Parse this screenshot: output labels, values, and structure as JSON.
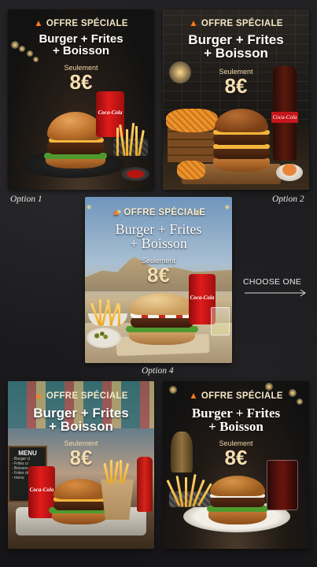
{
  "offers": [
    {
      "id": "opt1",
      "offer_title": "OFFRE SPÉCIALE",
      "headline_line1": "Burger + Frites",
      "headline_line2": "+ Boisson",
      "seulement": "Seulement",
      "price": "8€",
      "option_label": "Option 1",
      "can_logo": "Coca-Cola"
    },
    {
      "id": "opt2",
      "offer_title": "OFFRE SPÉCIALE",
      "headline_line1": "Burger + Frites",
      "headline_line2": "+ Boisson",
      "seulement": "Seulement",
      "price": "8€",
      "option_label": "Option 2",
      "can_logo": "Coca-Cola"
    },
    {
      "id": "opt4",
      "offer_title": "OFFRE SPÉCIALE",
      "headline_line1": "Burger + Frites",
      "headline_line2": "+ Boisson",
      "seulement": "Seulement",
      "price": "8€",
      "option_label": "Option 4",
      "can_logo": "Coca-Cola"
    },
    {
      "id": "opt5",
      "offer_title": "OFFRE SPÉCIALE",
      "headline_line1": "Burger + Frites",
      "headline_line2": "+ Boisson",
      "seulement": "Seulement",
      "price": "8€",
      "can_logo": "Coca-Cola",
      "menu_title": "MENU",
      "menu_lines": [
        "- Burger cl",
        "- Frites cr",
        "- Boisson",
        "- Frites di",
        "- menu"
      ]
    },
    {
      "id": "opt6",
      "offer_title": "OFFRE SPÉCIALE",
      "headline_line1": "Burger + Frites",
      "headline_line2": "+ Boisson",
      "seulement": "Seulement",
      "price": "8€"
    }
  ],
  "choose_one": "CHOOSE ONE",
  "icons": {
    "flame": "flame-icon",
    "arrow": "arrow-right-icon"
  },
  "colors": {
    "accent": "#f5ddb0",
    "coke_red": "#d71a1a",
    "background": "#1b1b1d"
  }
}
